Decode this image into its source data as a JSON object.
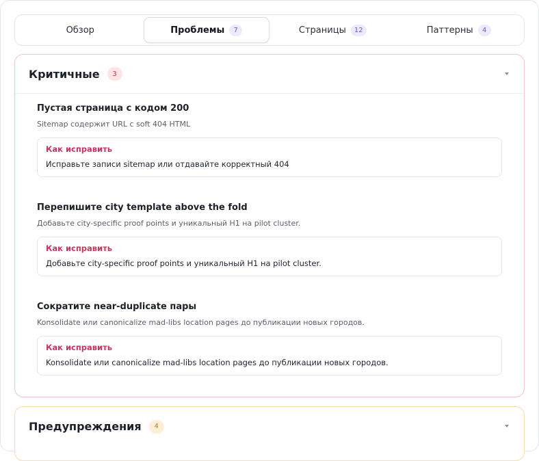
{
  "tabs": [
    {
      "label": "Обзор",
      "count": ""
    },
    {
      "label": "Проблемы",
      "count": "7"
    },
    {
      "label": "Страницы",
      "count": "12"
    },
    {
      "label": "Паттерны",
      "count": "4"
    }
  ],
  "active_tab": "Проблемы",
  "critical": {
    "title": "Критичные",
    "count": "3",
    "issues": [
      {
        "title": "Пустая страница с кодом 200",
        "description": "Sitemap содержит URL с soft 404 HTML",
        "fix_label": "Как исправить",
        "fix_text": "Исправьте записи sitemap или отдавайте корректный 404"
      },
      {
        "title": "Перепишите city template above the fold",
        "description": "Добавьте city-specific proof points и уникальный H1 на pilot cluster.",
        "fix_label": "Как исправить",
        "fix_text": "Добавьте city-specific proof points и уникальный H1 на pilot cluster."
      },
      {
        "title": "Сократите near-duplicate пары",
        "description": "Konsolidate или canonicalize mad-libs location pages до публикации новых городов.",
        "fix_label": "Как исправить",
        "fix_text": "Konsolidate или canonicalize mad-libs location pages до публикации новых городов."
      }
    ]
  },
  "warnings": {
    "title": "Предупреждения",
    "count": "4"
  },
  "colors": {
    "critical_border": "#f3c4cd",
    "warning_border": "#f4dcb0",
    "fix_label": "#c2375e",
    "tab_count_bg": "#eeeafc"
  },
  "icons": {
    "section_toggle": "chevron-down-icon"
  }
}
